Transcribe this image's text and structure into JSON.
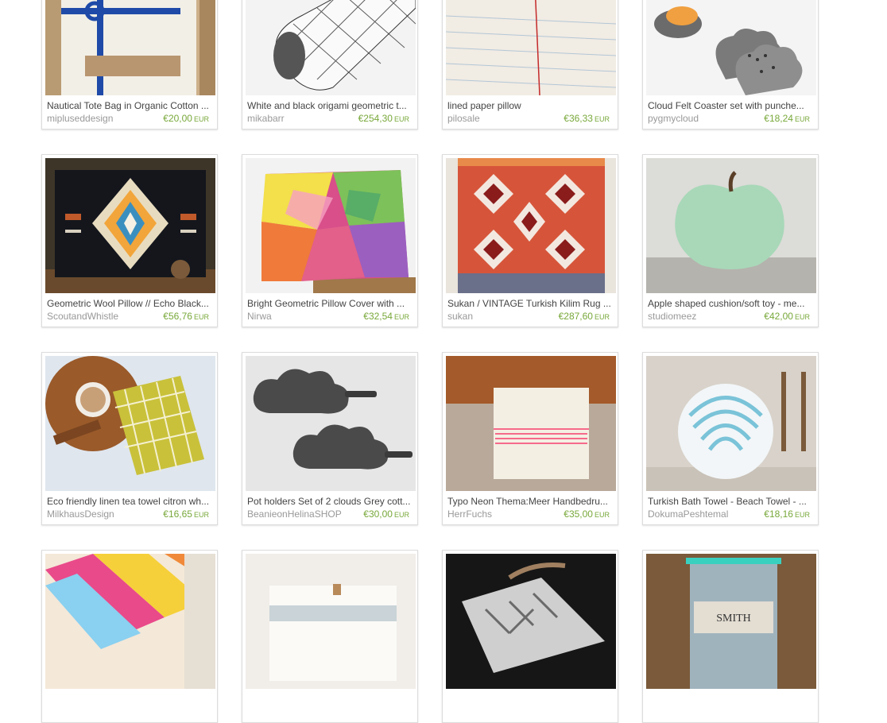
{
  "items": [
    {
      "title": "Nautical Tote Bag in Organic Cotton ...",
      "shop": "mipluseddesign",
      "price": "€20,00",
      "currency": "EUR",
      "image": "tote-bag-image"
    },
    {
      "title": "White and black origami geometric t...",
      "shop": "mikabarr",
      "price": "€254,30",
      "currency": "EUR",
      "image": "origami-roll-image"
    },
    {
      "title": "lined paper pillow",
      "shop": "pilosale",
      "price": "€36,33",
      "currency": "EUR",
      "image": "paper-pillow-image"
    },
    {
      "title": "Cloud Felt Coaster set with punche...",
      "shop": "pygmycloud",
      "price": "€18,24",
      "currency": "EUR",
      "image": "felt-coaster-image"
    },
    {
      "title": "Geometric Wool Pillow // Echo Black...",
      "shop": "ScoutandWhistle",
      "price": "€56,76",
      "currency": "EUR",
      "image": "wool-pillow-image"
    },
    {
      "title": "Bright Geometric Pillow Cover with ...",
      "shop": "Nirwa",
      "price": "€32,54",
      "currency": "EUR",
      "image": "bright-pillow-image"
    },
    {
      "title": "Sukan / VINTAGE Turkish Kilim Rug ...",
      "shop": "sukan",
      "price": "€287,60",
      "currency": "EUR",
      "image": "kilim-rug-image"
    },
    {
      "title": "Apple shaped cushion/soft toy - me...",
      "shop": "studiomeez",
      "price": "€42,00",
      "currency": "EUR",
      "image": "apple-cushion-image"
    },
    {
      "title": "Eco friendly linen tea towel citron wh...",
      "shop": "MilkhausDesign",
      "price": "€16,65",
      "currency": "EUR",
      "image": "tea-towel-image"
    },
    {
      "title": "Pot holders Set of 2 clouds Grey cott...",
      "shop": "BeanieonHelinaSHOP",
      "price": "€30,00",
      "currency": "EUR",
      "image": "pot-holders-image"
    },
    {
      "title": "Typo Neon Thema:Meer Handbedru...",
      "shop": "HerrFuchs",
      "price": "€35,00",
      "currency": "EUR",
      "image": "typo-pillow-image"
    },
    {
      "title": "Turkish Bath Towel - Beach Towel - ...",
      "shop": "DokumaPeshtemal",
      "price": "€18,16",
      "currency": "EUR",
      "image": "bath-towel-image"
    },
    {
      "title": "",
      "shop": "",
      "price": "",
      "currency": "",
      "image": "colorful-fabric-image"
    },
    {
      "title": "",
      "shop": "",
      "price": "",
      "currency": "",
      "image": "white-pillow-image"
    },
    {
      "title": "",
      "shop": "",
      "price": "",
      "currency": "",
      "image": "herringbone-image"
    },
    {
      "title": "",
      "shop": "",
      "price": "",
      "currency": "",
      "image": "smith-towel-image"
    }
  ],
  "partial_labels": {
    "smith_tag": "SMITH"
  }
}
